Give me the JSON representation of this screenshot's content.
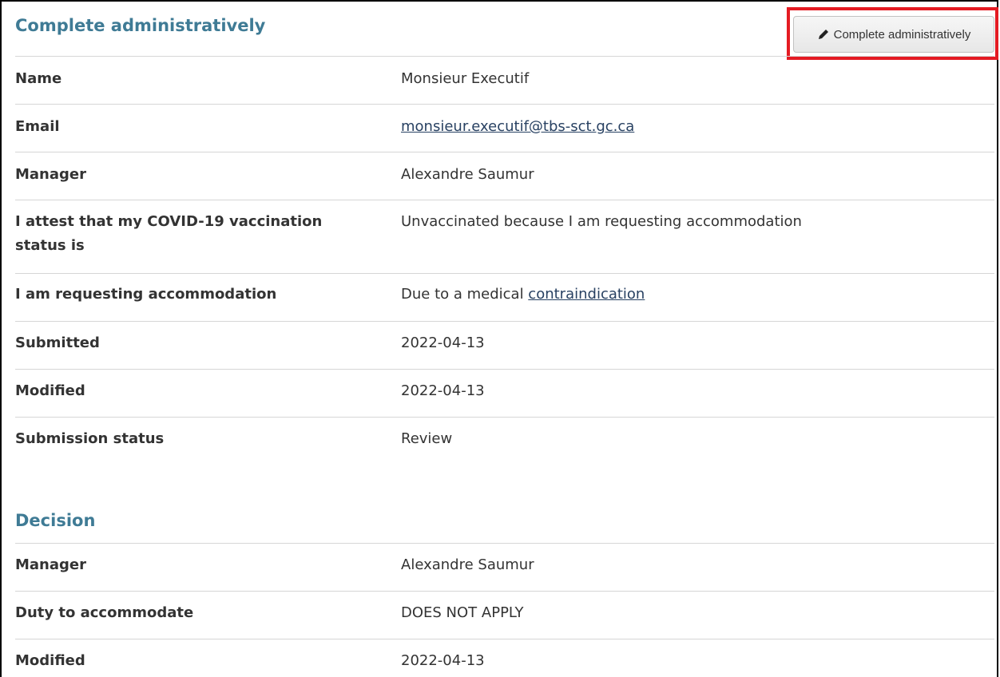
{
  "admin_section": {
    "title": "Complete administratively",
    "button_label": "Complete administratively",
    "button_icon": "pencil-icon",
    "rows": [
      {
        "label": "Name",
        "value": "Monsieur Executif"
      },
      {
        "label": "Email",
        "value": "monsieur.executif@tbs-sct.gc.ca"
      },
      {
        "label": "Manager",
        "value": "Alexandre Saumur"
      },
      {
        "label": "I attest that my COVID-19 vaccination status is",
        "value": "Unvaccinated because I am requesting accommodation"
      },
      {
        "label": "I am requesting accommodation",
        "value_prefix": "Due to a medical ",
        "value_link": "contraindication"
      },
      {
        "label": "Submitted",
        "value": "2022-04-13"
      },
      {
        "label": "Modified",
        "value": "2022-04-13"
      },
      {
        "label": "Submission status",
        "value": "Review"
      }
    ]
  },
  "decision_section": {
    "title": "Decision",
    "rows": [
      {
        "label": "Manager",
        "value": "Alexandre Saumur"
      },
      {
        "label": "Duty to accommodate",
        "value": "DOES NOT APPLY"
      },
      {
        "label": "Modified",
        "value": "2022-04-13"
      }
    ]
  },
  "colors": {
    "heading": "#3f7b95",
    "link": "#284162",
    "highlight_border": "#e41b23",
    "divider": "#d6d6d6"
  }
}
